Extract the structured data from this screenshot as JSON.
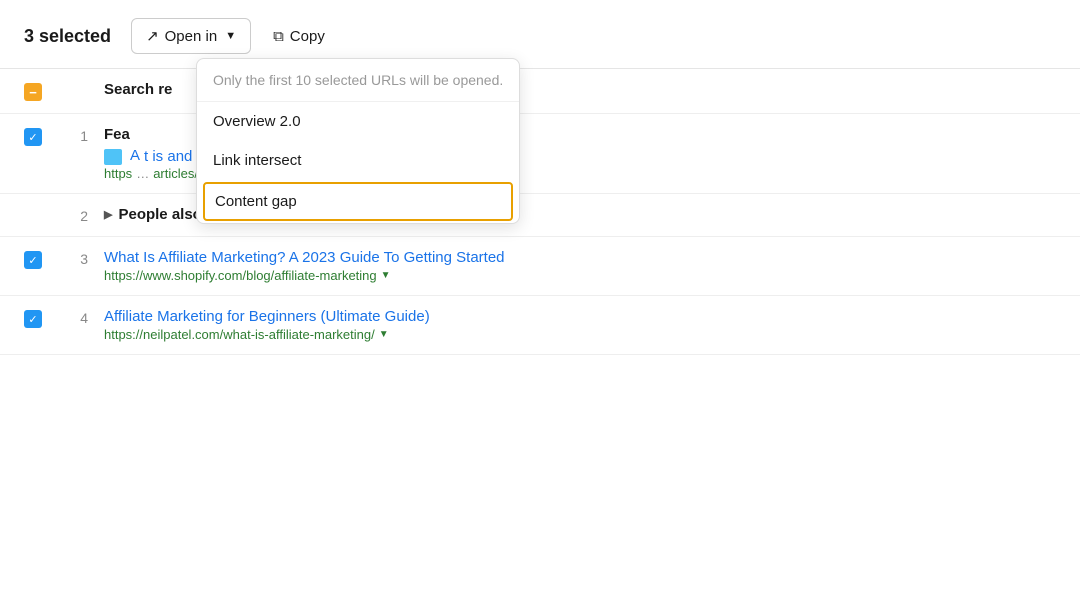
{
  "toolbar": {
    "selected_label": "3 selected",
    "open_in_button": "Open in",
    "copy_button": "Copy"
  },
  "dropdown": {
    "hint": "Only the first 10 selected URLs will be opened.",
    "items": [
      {
        "id": "overview",
        "label": "Overview 2.0",
        "highlighted": false
      },
      {
        "id": "link-intersect",
        "label": "Link intersect",
        "highlighted": false
      },
      {
        "id": "content-gap",
        "label": "Content gap",
        "highlighted": true
      }
    ]
  },
  "rows": [
    {
      "id": "search-results-header",
      "type": "header",
      "checkbox": "minus",
      "num": "",
      "title": "Search re"
    },
    {
      "id": "row-1",
      "type": "result",
      "checkbox": "checked",
      "num": "1",
      "title": "Fea",
      "link_title": "A",
      "link_suffix": "t is and How to Get Started",
      "url_prefix": "https",
      "url_suffix": "articles/ecommerce/affiliate-marketing/",
      "has_thumbnail": true
    },
    {
      "id": "row-2",
      "type": "paa",
      "checkbox": "none",
      "num": "2",
      "title": "People also ask"
    },
    {
      "id": "row-3",
      "type": "result",
      "checkbox": "checked",
      "num": "3",
      "link_title": "What Is Affiliate Marketing? A 2023 Guide To Getting Started",
      "url": "https://www.shopify.com/blog/affiliate-marketing"
    },
    {
      "id": "row-4",
      "type": "result",
      "checkbox": "checked",
      "num": "4",
      "link_title": "Affiliate Marketing for Beginners (Ultimate Guide)",
      "url": "https://neilpatel.com/what-is-affiliate-marketing/"
    }
  ]
}
